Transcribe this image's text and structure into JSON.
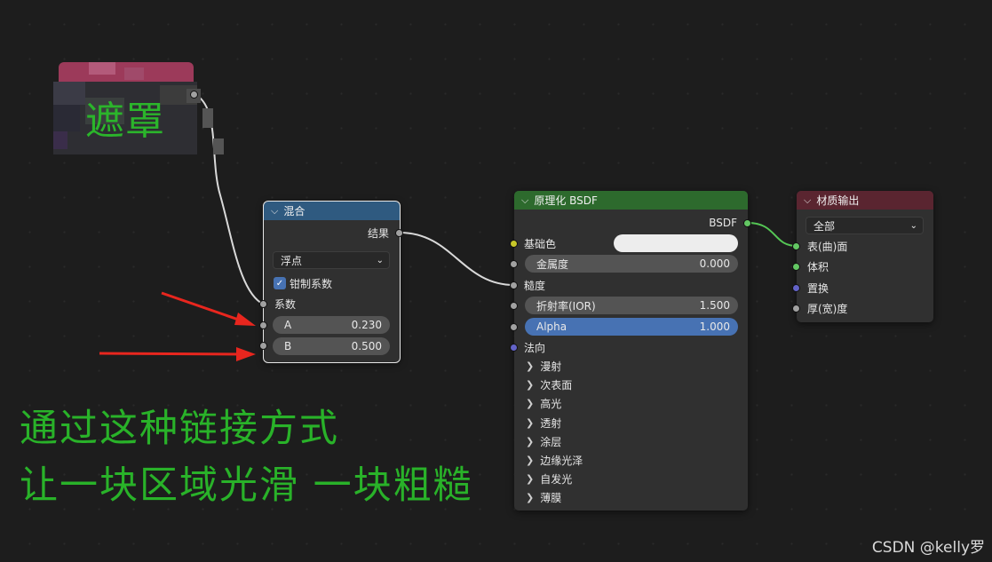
{
  "mask_label": "遮罩",
  "mix_node": {
    "title": "混合",
    "output_label": "结果",
    "data_type": "浮点",
    "clamp_label": "钳制系数",
    "clamp_checked": true,
    "factor_label": "系数",
    "a_label": "A",
    "a_value": "0.230",
    "b_label": "B",
    "b_value": "0.500"
  },
  "bsdf_node": {
    "title": "原理化 BSDF",
    "output_label": "BSDF",
    "base_color_label": "基础色",
    "metallic_label": "金属度",
    "metallic_value": "0.000",
    "roughness_label": "糙度",
    "ior_label": "折射率(IOR)",
    "ior_value": "1.500",
    "alpha_label": "Alpha",
    "alpha_value": "1.000",
    "normal_label": "法向",
    "panels": [
      "漫射",
      "次表面",
      "高光",
      "透射",
      "涂层",
      "边缘光泽",
      "自发光",
      "薄膜"
    ]
  },
  "output_node": {
    "title": "材质输出",
    "target": "全部",
    "inputs": [
      "表(曲)面",
      "体积",
      "置换",
      "厚(宽)度"
    ]
  },
  "annotation": {
    "line1": "通过这种链接方式",
    "line2": "让一块区域光滑 一块粗糙"
  },
  "watermark": "CSDN @kelly罗",
  "colors": {
    "mix_header": "#2f5a80",
    "bsdf_header": "#2d6a2d",
    "output_header": "#5a2530",
    "socket_float": "#a1a1a1",
    "socket_color": "#c7c729",
    "socket_vector": "#6363c7",
    "socket_shader": "#63c763",
    "annotation_text": "#29b229",
    "arrow": "#e8261e"
  }
}
